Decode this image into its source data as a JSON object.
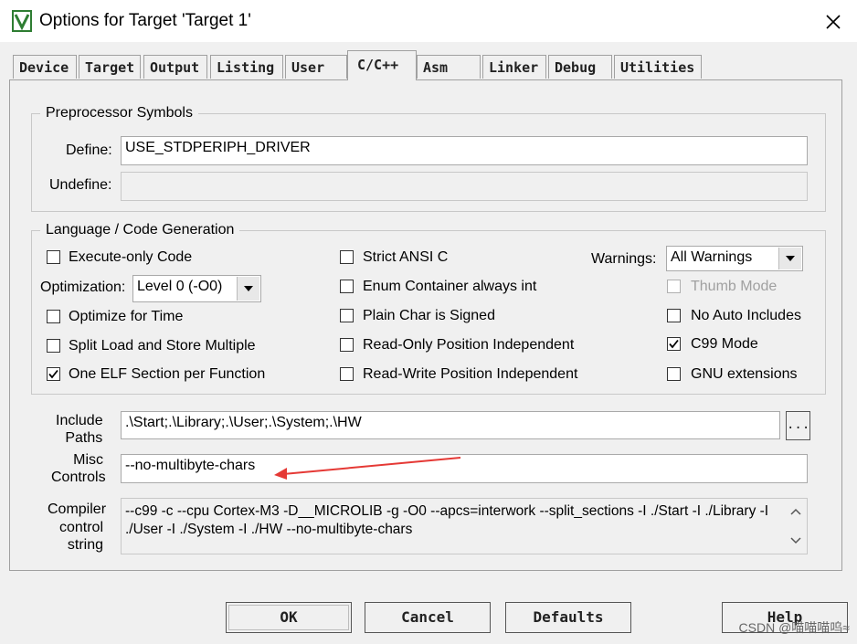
{
  "window": {
    "title": "Options for Target 'Target 1'"
  },
  "tabs": [
    "Device",
    "Target",
    "Output",
    "Listing",
    "User",
    "C/C++",
    "Asm",
    "Linker",
    "Debug",
    "Utilities"
  ],
  "preprocessor": {
    "legend": "Preprocessor Symbols",
    "define_label": "Define:",
    "define_value": "USE_STDPERIPH_DRIVER",
    "undefine_label": "Undefine:",
    "undefine_value": ""
  },
  "language": {
    "legend": "Language / Code Generation",
    "execute_only": {
      "label": "Execute-only Code",
      "checked": false
    },
    "optimization_label": "Optimization:",
    "optimization_value": "Level 0 (-O0)",
    "optimize_time": {
      "label": "Optimize for Time",
      "checked": false
    },
    "split_load": {
      "label": "Split Load and Store Multiple",
      "checked": false
    },
    "one_elf": {
      "label": "One ELF Section per Function",
      "checked": true
    },
    "strict_ansi": {
      "label": "Strict ANSI C",
      "checked": false
    },
    "enum_container": {
      "label": "Enum Container always int",
      "checked": false
    },
    "plain_char": {
      "label": "Plain Char is Signed",
      "checked": false
    },
    "ro_pi": {
      "label": "Read-Only Position Independent",
      "checked": false
    },
    "rw_pi": {
      "label": "Read-Write Position Independent",
      "checked": false
    },
    "warnings_label": "Warnings:",
    "warnings_value": "All Warnings",
    "thumb_mode": {
      "label": "Thumb Mode",
      "checked": false,
      "disabled": true
    },
    "no_auto_includes": {
      "label": "No Auto Includes",
      "checked": false
    },
    "c99_mode": {
      "label": "C99 Mode",
      "checked": true
    },
    "gnu_ext": {
      "label": "GNU extensions",
      "checked": false
    }
  },
  "include": {
    "label_line1": "Include",
    "label_line2": "Paths",
    "value": ".\\Start;.\\Library;.\\User;.\\System;.\\HW",
    "browse_label": "..."
  },
  "misc": {
    "label_line1": "Misc",
    "label_line2": "Controls",
    "value": "--no-multibyte-chars"
  },
  "compiler": {
    "label_line1": "Compiler",
    "label_line2": "control",
    "label_line3": "string",
    "line1": "--c99 -c --cpu Cortex-M3 -D__MICROLIB -g -O0 --apcs=interwork --split_sections -I ./Start -I ./Library -I",
    "line2": "./User -I ./System -I ./HW --no-multibyte-chars"
  },
  "buttons": {
    "ok": "OK",
    "cancel": "Cancel",
    "defaults": "Defaults",
    "help": "Help"
  },
  "watermark": "CSDN @喵喵喵呜≈",
  "colors": {
    "arrow": "#e53935",
    "check": "#000000"
  }
}
